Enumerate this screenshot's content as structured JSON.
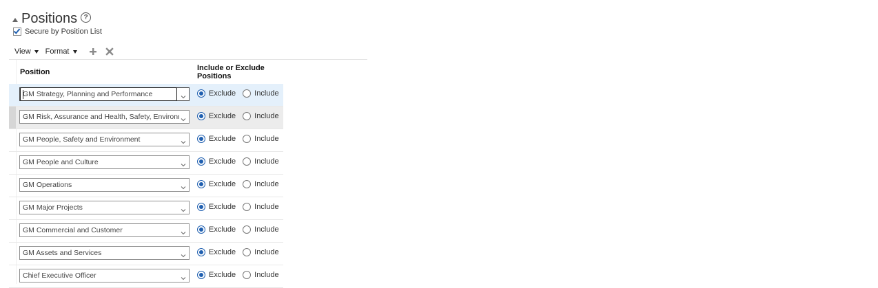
{
  "section": {
    "title": "Positions",
    "help_glyph": "?"
  },
  "secure_by_list": {
    "label": "Secure by Position List",
    "checked": true
  },
  "toolbar": {
    "view_label": "View",
    "format_label": "Format",
    "add_icon": "plus-icon",
    "remove_icon": "close-icon"
  },
  "table": {
    "col_position": "Position",
    "col_include_exclude": "Include or Exclude Positions",
    "rows": [
      {
        "position": "GM Strategy, Planning and Performance",
        "exclude_label": "Exclude",
        "include_label": "Include",
        "selected": "Exclude"
      },
      {
        "position": "GM Risk, Assurance and Health, Safety, Environment",
        "exclude_label": "Exclude",
        "include_label": "Include",
        "selected": "Exclude"
      },
      {
        "position": "GM People, Safety and Environment",
        "exclude_label": "Exclude",
        "include_label": "Include",
        "selected": "Exclude"
      },
      {
        "position": "GM People and Culture",
        "exclude_label": "Exclude",
        "include_label": "Include",
        "selected": "Exclude"
      },
      {
        "position": "GM Operations",
        "exclude_label": "Exclude",
        "include_label": "Include",
        "selected": "Exclude"
      },
      {
        "position": "GM Major Projects",
        "exclude_label": "Exclude",
        "include_label": "Include",
        "selected": "Exclude"
      },
      {
        "position": "GM Commercial and Customer",
        "exclude_label": "Exclude",
        "include_label": "Include",
        "selected": "Exclude"
      },
      {
        "position": "GM Assets and Services",
        "exclude_label": "Exclude",
        "include_label": "Include",
        "selected": "Exclude"
      },
      {
        "position": "Chief Executive Officer",
        "exclude_label": "Exclude",
        "include_label": "Include",
        "selected": "Exclude"
      }
    ]
  }
}
